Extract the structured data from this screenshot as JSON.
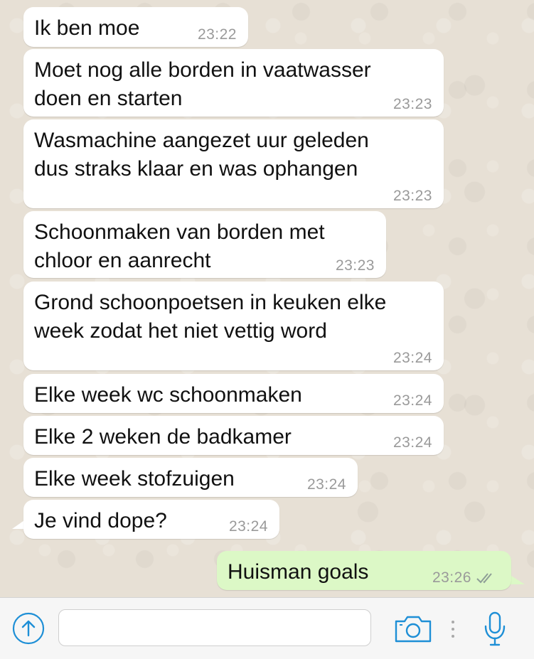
{
  "colors": {
    "incoming_bubble": "#ffffff",
    "outgoing_bubble": "#dcf8c6",
    "accent": "#1e8fd6",
    "timestamp": "#9a9a9a"
  },
  "messages": [
    {
      "direction": "incoming",
      "text": "Ik ben moe",
      "time": "23:22"
    },
    {
      "direction": "incoming",
      "text": "Moet nog alle borden in vaatwasser\ndoen en starten",
      "time": "23:23"
    },
    {
      "direction": "incoming",
      "text": "Wasmachine aangezet uur geleden\ndus straks klaar en was ophangen",
      "time": "23:23"
    },
    {
      "direction": "incoming",
      "text": "Schoonmaken van borden met\nchloor en aanrecht",
      "time": "23:23"
    },
    {
      "direction": "incoming",
      "text": "Grond schoonpoetsen in keuken elke\nweek zodat het niet vettig word",
      "time": "23:24"
    },
    {
      "direction": "incoming",
      "text": "Elke week wc schoonmaken",
      "time": "23:24"
    },
    {
      "direction": "incoming",
      "text": "Elke 2 weken de badkamer",
      "time": "23:24"
    },
    {
      "direction": "incoming",
      "text": "Elke week stofzuigen",
      "time": "23:24"
    },
    {
      "direction": "incoming",
      "text": "Je vind dope?",
      "time": "23:24"
    },
    {
      "direction": "outgoing",
      "text": "Huisman goals",
      "time": "23:26",
      "status": "read-double-check-icon"
    }
  ],
  "input_bar": {
    "message_placeholder": "",
    "icons": [
      "share-arrow-icon",
      "camera-icon",
      "more-dots-icon",
      "microphone-icon"
    ]
  }
}
